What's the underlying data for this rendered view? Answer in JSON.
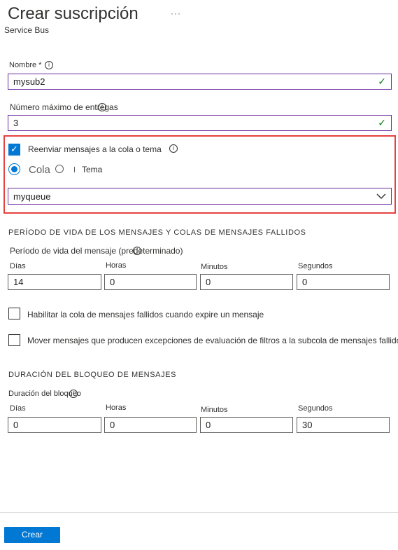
{
  "header": {
    "title": "Crear suscripción",
    "more": "···",
    "subtitle": "Service Bus"
  },
  "name_field": {
    "label": "Nombre *",
    "value": "mysub2"
  },
  "max_delivery": {
    "label": "Número máximo de entregas",
    "value": "3"
  },
  "forward": {
    "checkbox_label": "Reenviar mensajes a la cola o tema",
    "checked": true,
    "radio_queue": "Cola",
    "radio_topic": "Tema",
    "selected": "Cola",
    "target_value": "myqueue"
  },
  "ttl_section": {
    "heading": "PERÍODO DE VIDA DE LOS MENSAJES Y COLAS DE MENSAJES FALLIDOS",
    "sub_label": "Período de vida del mensaje (predeterminado)",
    "days_label": "Días",
    "hours_label": "Horas",
    "minutes_label": "Minutos",
    "seconds_label": "Segundos",
    "days": "14",
    "hours": "0",
    "minutes": "0",
    "seconds": "0"
  },
  "options": {
    "dead_letter_expire": "Habilitar la cola de mensajes fallidos cuando expire un mensaje",
    "dead_letter_filter": "Mover mensajes que producen excepciones de evaluación de filtros a la subcola de mensajes fallidos"
  },
  "lock_section": {
    "heading": "DURACIÓN DEL BLOQUEO DE MENSAJES",
    "sub_label": "Duración del bloqueo",
    "days_label": "Días",
    "hours_label": "Horas",
    "minutes_label": "Minutos",
    "seconds_label": "Segundos",
    "days": "0",
    "hours": "0",
    "minutes": "0",
    "seconds": "30"
  },
  "footer": {
    "create_label": "Crear"
  },
  "colors": {
    "accent": "#0078d4",
    "field_border": "#6b2a9e",
    "valid": "#107c10",
    "highlight": "#e5423f"
  }
}
